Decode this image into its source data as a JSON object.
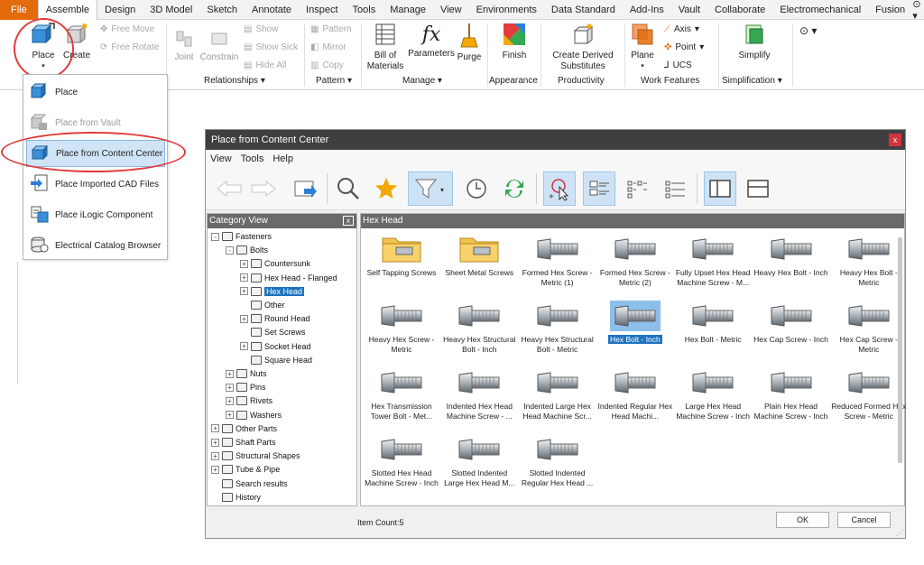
{
  "menubar": {
    "tabs": [
      "File",
      "Assemble",
      "Design",
      "3D Model",
      "Sketch",
      "Annotate",
      "Inspect",
      "Tools",
      "Manage",
      "View",
      "Environments",
      "Data Standard",
      "Add-Ins",
      "Vault",
      "Collaborate",
      "Electromechanical",
      "Fusion"
    ],
    "active_tab": "Assemble",
    "extra_icon": "dropdown-dot-icon"
  },
  "ribbon": {
    "place": "Place",
    "create": "Create",
    "free_move": "Free Move",
    "free_rotate": "Free Rotate",
    "joint": "Joint",
    "constrain": "Constrain",
    "show": "Show",
    "show_sick": "Show Sick",
    "hide_all": "Hide All",
    "pattern": "Pattern",
    "mirror": "Mirror",
    "copy": "Copy",
    "bill_of": "Bill of",
    "materials": "Materials",
    "parameters": "Parameters",
    "purge": "Purge",
    "finish": "Finish",
    "create_derived": "Create Derived",
    "substitutes": "Substitutes",
    "plane": "Plane",
    "axis": "Axis",
    "point": "Point",
    "ucs": "UCS",
    "simplify": "Simplify",
    "groups": {
      "relationships": "Relationships",
      "pattern": "Pattern",
      "manage": "Manage",
      "appearance": "Appearance",
      "productivity": "Productivity",
      "work_features": "Work Features",
      "simplification": "Simplification"
    }
  },
  "place_menu": {
    "items": [
      {
        "label": "Place",
        "icon": "place-icon",
        "enabled": true
      },
      {
        "label": "Place from Vault",
        "icon": "vault-icon",
        "enabled": false
      },
      {
        "label": "Place from Content Center",
        "icon": "content-center-icon",
        "enabled": true,
        "highlighted": true
      },
      {
        "label": "Place Imported CAD Files",
        "icon": "imported-cad-icon",
        "enabled": true
      },
      {
        "label": "Place iLogic Component",
        "icon": "ilogic-icon",
        "enabled": true
      },
      {
        "label": "Electrical  Catalog Browser",
        "icon": "electrical-catalog-icon",
        "enabled": true
      }
    ]
  },
  "dialog": {
    "title": "Place from Content Center",
    "close": "x",
    "menu": [
      "View",
      "Tools",
      "Help"
    ],
    "category_header": "Category View",
    "category_close": "x",
    "content_header": "Hex Head",
    "item_count": "Item Count:5",
    "ok": "OK",
    "cancel": "Cancel"
  },
  "tree": [
    {
      "label": "Fasteners",
      "depth": 0,
      "exp": "-"
    },
    {
      "label": "Bolts",
      "depth": 1,
      "exp": "-"
    },
    {
      "label": "Countersunk",
      "depth": 2,
      "exp": "+"
    },
    {
      "label": "Hex Head - Flanged",
      "depth": 2,
      "exp": "+"
    },
    {
      "label": "Hex Head",
      "depth": 2,
      "exp": "+",
      "selected": true
    },
    {
      "label": "Other",
      "depth": 2,
      "exp": ""
    },
    {
      "label": "Round Head",
      "depth": 2,
      "exp": "+"
    },
    {
      "label": "Set Screws",
      "depth": 2,
      "exp": ""
    },
    {
      "label": "Socket Head",
      "depth": 2,
      "exp": "+"
    },
    {
      "label": "Square Head",
      "depth": 2,
      "exp": ""
    },
    {
      "label": "Nuts",
      "depth": 1,
      "exp": "+"
    },
    {
      "label": "Pins",
      "depth": 1,
      "exp": "+"
    },
    {
      "label": "Rivets",
      "depth": 1,
      "exp": "+"
    },
    {
      "label": "Washers",
      "depth": 1,
      "exp": "+"
    },
    {
      "label": "Other Parts",
      "depth": 0,
      "exp": "+"
    },
    {
      "label": "Shaft Parts",
      "depth": 0,
      "exp": "+"
    },
    {
      "label": "Structural Shapes",
      "depth": 0,
      "exp": "+"
    },
    {
      "label": "Tube & Pipe",
      "depth": 0,
      "exp": "+"
    },
    {
      "label": "Search results",
      "depth": 0,
      "exp": ""
    },
    {
      "label": "History",
      "depth": 0,
      "exp": ""
    }
  ],
  "items": [
    {
      "label": "Self Tapping Screws",
      "kind": "folder"
    },
    {
      "label": "Sheet Metal Screws",
      "kind": "folder"
    },
    {
      "label": "Formed Hex Screw - Metric (1)",
      "kind": "bolt"
    },
    {
      "label": "Formed Hex Screw - Metric (2)",
      "kind": "bolt"
    },
    {
      "label": "Fully Upset Hex Head Machine Screw - M...",
      "kind": "bolt"
    },
    {
      "label": "Heavy Hex Bolt - Inch",
      "kind": "bolt"
    },
    {
      "label": "Heavy Hex Bolt - Metric",
      "kind": "bolt"
    },
    {
      "label": "Heavy Hex Screw - Metric",
      "kind": "bolt"
    },
    {
      "label": "Heavy Hex Structural Bolt - Inch",
      "kind": "bolt"
    },
    {
      "label": "Heavy Hex Structural Bolt - Metric",
      "kind": "bolt"
    },
    {
      "label": "Hex Bolt - Inch",
      "kind": "bolt",
      "selected": true
    },
    {
      "label": "Hex Bolt - Metric",
      "kind": "bolt"
    },
    {
      "label": "Hex Cap Screw - Inch",
      "kind": "bolt"
    },
    {
      "label": "Hex Cap Screw - Metric",
      "kind": "bolt"
    },
    {
      "label": "Hex Transmission Tower Bolt - Met...",
      "kind": "bolt"
    },
    {
      "label": "Indented Hex Head Machine Screw - ...",
      "kind": "bolt"
    },
    {
      "label": "Indented Large Hex Head Machine Scr...",
      "kind": "bolt"
    },
    {
      "label": "Indented Regular Hex Head Machi...",
      "kind": "bolt"
    },
    {
      "label": "Large Hex Head Machine Screw - Inch",
      "kind": "bolt"
    },
    {
      "label": "Plain Hex Head Machine Screw - Inch",
      "kind": "bolt"
    },
    {
      "label": "Reduced Formed Hex Screw - Metric",
      "kind": "bolt"
    },
    {
      "label": "Slotted Hex Head Machine Screw - Inch",
      "kind": "bolt"
    },
    {
      "label": "Slotted Indented Large Hex Head M...",
      "kind": "bolt"
    },
    {
      "label": "Slotted Indented Regular Hex Head ...",
      "kind": "bolt"
    }
  ]
}
